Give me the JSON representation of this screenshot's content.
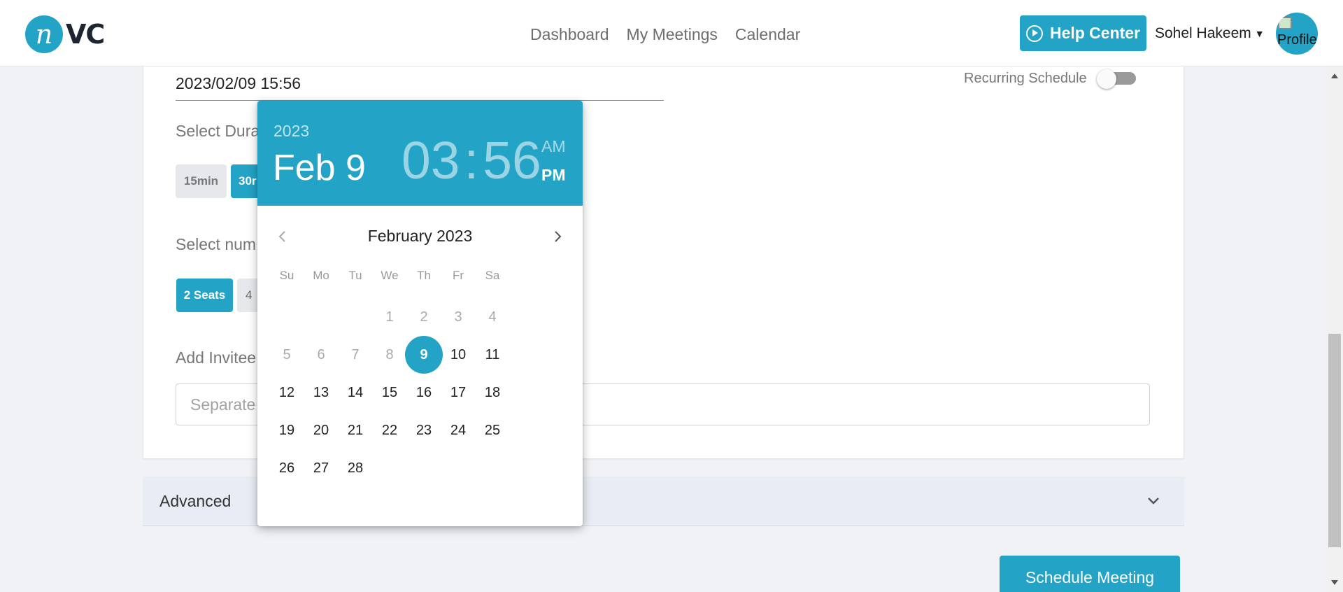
{
  "header": {
    "logo_letter": "n",
    "logo_text": "VC",
    "nav": [
      "Dashboard",
      "My Meetings",
      "Calendar"
    ],
    "help_label": "Help Center",
    "user_name": "Sohel Hakeem",
    "avatar_alt": "Profile"
  },
  "form": {
    "datetime_value": "2023/02/09 15:56",
    "recurring_label": "Recurring Schedule",
    "recurring_on": false,
    "duration_label": "Select Dura",
    "duration_chips": [
      "15min",
      "30r"
    ],
    "seats_label": "Select num",
    "seat_chips": [
      "2 Seats",
      "4"
    ],
    "invitees_label": "Add Invitee",
    "invitees_placeholder": "Separate",
    "advanced_label": "Advanced",
    "schedule_label": "Schedule Meeting"
  },
  "picker": {
    "year": "2023",
    "date": "Feb 9",
    "hour": "03",
    "minute": "56",
    "am": "AM",
    "pm": "PM",
    "meridiem_selected": "PM",
    "month_label": "February 2023",
    "weekdays": [
      "Su",
      "Mo",
      "Tu",
      "We",
      "Th",
      "Fr",
      "Sa"
    ],
    "first_weekday_index": 3,
    "days_in_month": 28,
    "selected_day": 9,
    "today_day": 9
  },
  "colors": {
    "accent": "#23a3c5",
    "page_bg": "#f1f2f6"
  }
}
